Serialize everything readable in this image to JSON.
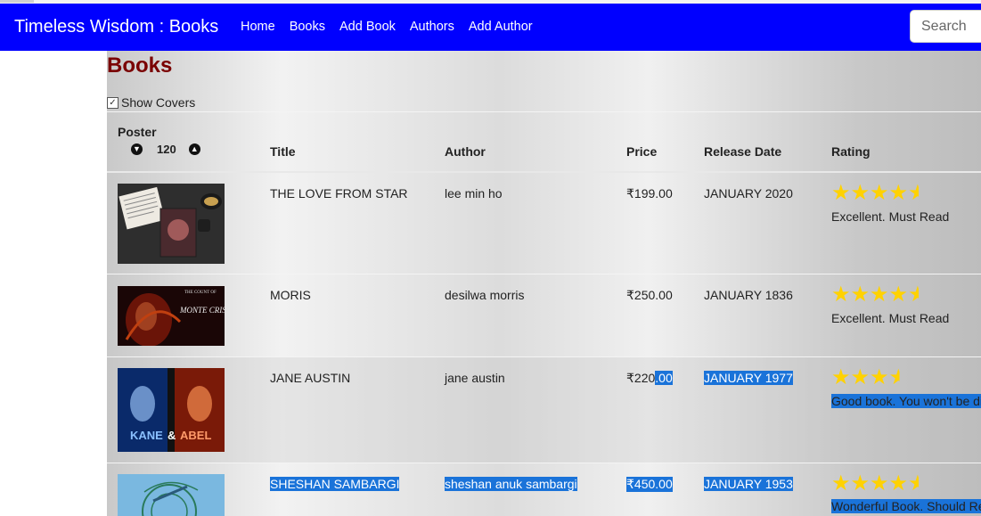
{
  "navbar": {
    "brand": "Timeless Wisdom : Books",
    "links": [
      "Home",
      "Books",
      "Add Book",
      "Authors",
      "Add Author"
    ],
    "search_placeholder": "Search",
    "bg_color": "#0000ff"
  },
  "page": {
    "title": "Books",
    "show_covers_label": "Show Covers",
    "show_covers_checked": true
  },
  "table": {
    "headers": {
      "poster": "Poster",
      "poster_size": "120",
      "title": "Title",
      "author": "Author",
      "price": "Price",
      "release": "Release Date",
      "rating": "Rating"
    },
    "rows": [
      {
        "title": "THE LOVE FROM STAR",
        "author": "lee min ho",
        "price": "₹199.00",
        "release": "JANUARY 2020",
        "stars": 4.5,
        "rating_text": "Excellent. Must Read"
      },
      {
        "title": "MORIS",
        "author": "desilwa morris",
        "price": "₹250.00",
        "release": "JANUARY 1836",
        "stars": 4.5,
        "rating_text": "Excellent. Must Read"
      },
      {
        "title": "JANE AUSTIN",
        "author": "jane austin",
        "price": "₹220.00",
        "price_plain": "₹220",
        "price_sel": ".00",
        "release": "JANUARY 1977",
        "stars": 3.5,
        "rating_text": "Good book. You won't be di"
      },
      {
        "title": "SHESHAN SAMBARGI",
        "author": "sheshan anuk sambargi",
        "price": "₹450.00",
        "release": "JANUARY 1953",
        "stars": 4.5,
        "rating_text": "Wonderful Book. Should Re"
      }
    ],
    "cover_labels": {
      "row2_top": "THE COUNT OF",
      "row2_main": "MONTE CRISTO",
      "row3_left": "KANE",
      "row3_amp": "&",
      "row3_right": "ABEL"
    }
  },
  "colors": {
    "title_color": "#7a0000",
    "star_color": "#ffd200",
    "selection": "#1a73d9"
  }
}
